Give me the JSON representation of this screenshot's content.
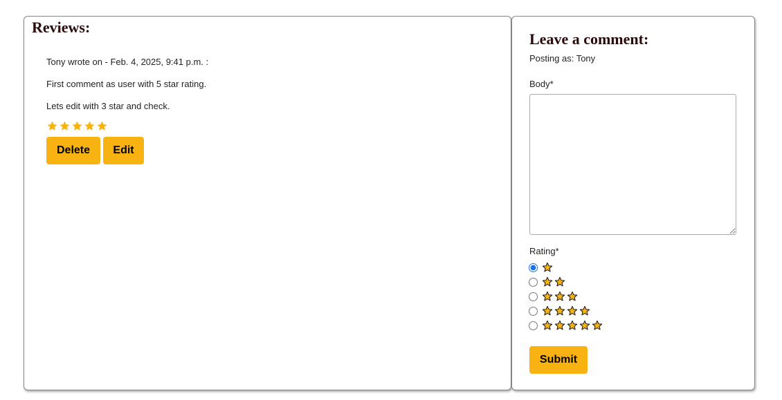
{
  "reviews": {
    "title": "Reviews:",
    "items": [
      {
        "author_line": "Tony wrote on - Feb. 4, 2025, 9:41 p.m. :",
        "body_line_1": "First comment as user with 5 star rating.",
        "body_line_2": "Lets edit with 3 star and check.",
        "rating": 5,
        "delete_label": "Delete",
        "edit_label": "Edit"
      }
    ]
  },
  "comment_form": {
    "title": "Leave a comment:",
    "posting_as": "Posting as: Tony",
    "body_label": "Body*",
    "body_value": "",
    "rating_label": "Rating*",
    "rating_options": [
      1,
      2,
      3,
      4,
      5
    ],
    "selected_rating": 1,
    "submit_label": "Submit"
  },
  "colors": {
    "accent": "#f8b212",
    "heading": "#2a0a0a",
    "star_fill": "#f8b212",
    "radio_selected": "#1a73e8"
  },
  "icons": {
    "review_star": "star-icon",
    "option_star": "outlined-star-icon"
  }
}
